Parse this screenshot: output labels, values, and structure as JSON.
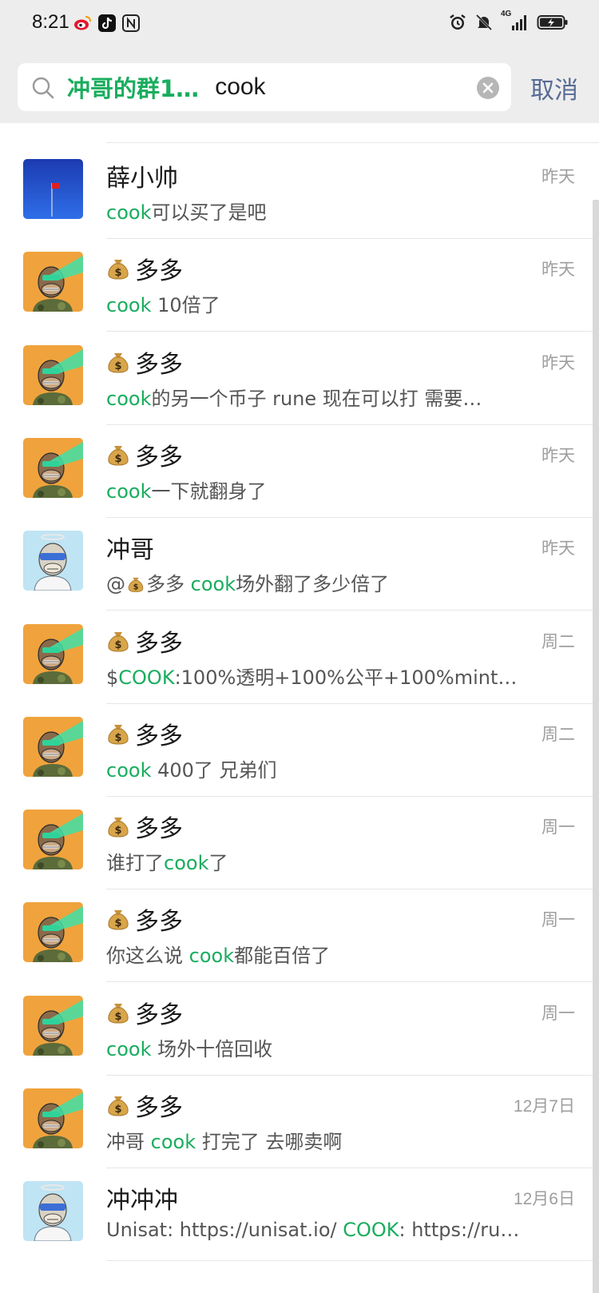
{
  "status_bar": {
    "time": "8:21",
    "left_icons": [
      "weibo-icon",
      "tiktok-icon",
      "nfc-icon"
    ],
    "right_icons": [
      "alarm-icon",
      "mute-icon",
      "4g-signal-icon",
      "battery-charging-icon"
    ],
    "network_label": "4G"
  },
  "search": {
    "chip": "冲哥的群1…",
    "query": "cook",
    "cancel_label": "取消"
  },
  "colors": {
    "highlight": "#19ad5e",
    "cancel": "#576b95",
    "header_bg": "#ededed"
  },
  "results": [
    {
      "name": "薛小帅",
      "has_emoji": false,
      "avatar": "flag",
      "date": "昨天",
      "snippet": [
        {
          "t": "cook",
          "h": true
        },
        {
          "t": "可以买了是吧"
        }
      ]
    },
    {
      "name": "多多",
      "has_emoji": true,
      "avatar": "ape",
      "date": "昨天",
      "snippet": [
        {
          "t": "cook",
          "h": true
        },
        {
          "t": " 10倍了"
        }
      ]
    },
    {
      "name": "多多",
      "has_emoji": true,
      "avatar": "ape",
      "date": "昨天",
      "snippet": [
        {
          "t": "cook",
          "h": true
        },
        {
          "t": "的另一个币子 rune  现在可以打  需要…"
        }
      ]
    },
    {
      "name": "多多",
      "has_emoji": true,
      "avatar": "ape",
      "date": "昨天",
      "snippet": [
        {
          "t": "cook",
          "h": true
        },
        {
          "t": "一下就翻身了"
        }
      ]
    },
    {
      "name": "冲哥",
      "has_emoji": false,
      "avatar": "ape-blue",
      "date": "昨天",
      "snippet": [
        {
          "t": "@"
        },
        {
          "emoji": true
        },
        {
          "t": "多多 "
        },
        {
          "t": "cook",
          "h": true
        },
        {
          "t": "场外翻了多少倍了"
        }
      ]
    },
    {
      "name": "多多",
      "has_emoji": true,
      "avatar": "ape",
      "date": "周二",
      "snippet": [
        {
          "t": "$"
        },
        {
          "t": "COOK",
          "h": true
        },
        {
          "t": ":100%透明+100%公平+100%mint…"
        }
      ]
    },
    {
      "name": "多多",
      "has_emoji": true,
      "avatar": "ape",
      "date": "周二",
      "snippet": [
        {
          "t": "cook",
          "h": true
        },
        {
          "t": "  400了 兄弟们"
        }
      ]
    },
    {
      "name": "多多",
      "has_emoji": true,
      "avatar": "ape",
      "date": "周一",
      "snippet": [
        {
          "t": "谁打了"
        },
        {
          "t": "cook",
          "h": true
        },
        {
          "t": "了"
        }
      ]
    },
    {
      "name": "多多",
      "has_emoji": true,
      "avatar": "ape",
      "date": "周一",
      "snippet": [
        {
          "t": "你这么说  "
        },
        {
          "t": "cook",
          "h": true
        },
        {
          "t": "都能百倍了"
        }
      ]
    },
    {
      "name": "多多",
      "has_emoji": true,
      "avatar": "ape",
      "date": "周一",
      "snippet": [
        {
          "t": "cook",
          "h": true
        },
        {
          "t": "  场外十倍回收"
        }
      ]
    },
    {
      "name": "多多",
      "has_emoji": true,
      "avatar": "ape",
      "date": "12月7日",
      "snippet": [
        {
          "t": "冲哥 "
        },
        {
          "t": "cook",
          "h": true
        },
        {
          "t": " 打完了  去哪卖啊"
        }
      ]
    },
    {
      "name": "冲冲冲",
      "has_emoji": false,
      "avatar": "ape-blue",
      "date": "12月6日",
      "snippet": [
        {
          "t": "Unisat: https://unisat.io/ "
        },
        {
          "t": "COOK",
          "h": true
        },
        {
          "t": ": https://ru…"
        }
      ]
    }
  ]
}
